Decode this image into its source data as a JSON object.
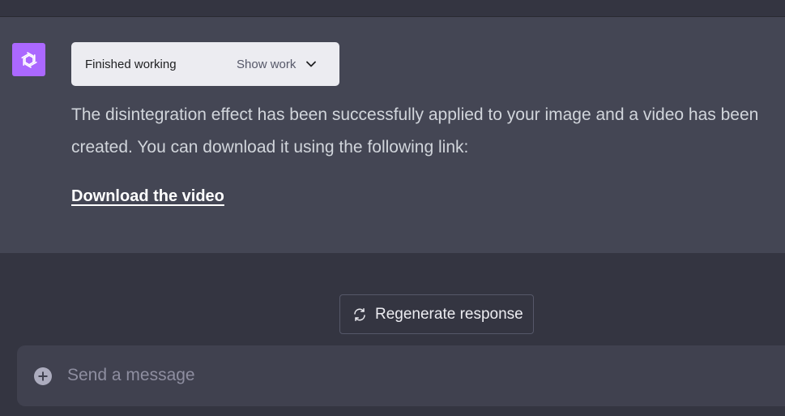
{
  "assistant": {
    "avatar_icon": "openai-logo-icon",
    "avatar_color": "#ab68ff"
  },
  "tool_status": {
    "label": "Finished working",
    "toggle_label": "Show work",
    "toggle_icon": "chevron-down-icon"
  },
  "message": {
    "text": "The disintegration effect has been successfully applied to your image and a video has been created. You can download it using the following link:",
    "link_label": "Download the video"
  },
  "regenerate": {
    "label": "Regenerate response",
    "icon": "refresh-icon"
  },
  "composer": {
    "placeholder": "Send a message",
    "icon": "plus-circle-icon"
  }
}
